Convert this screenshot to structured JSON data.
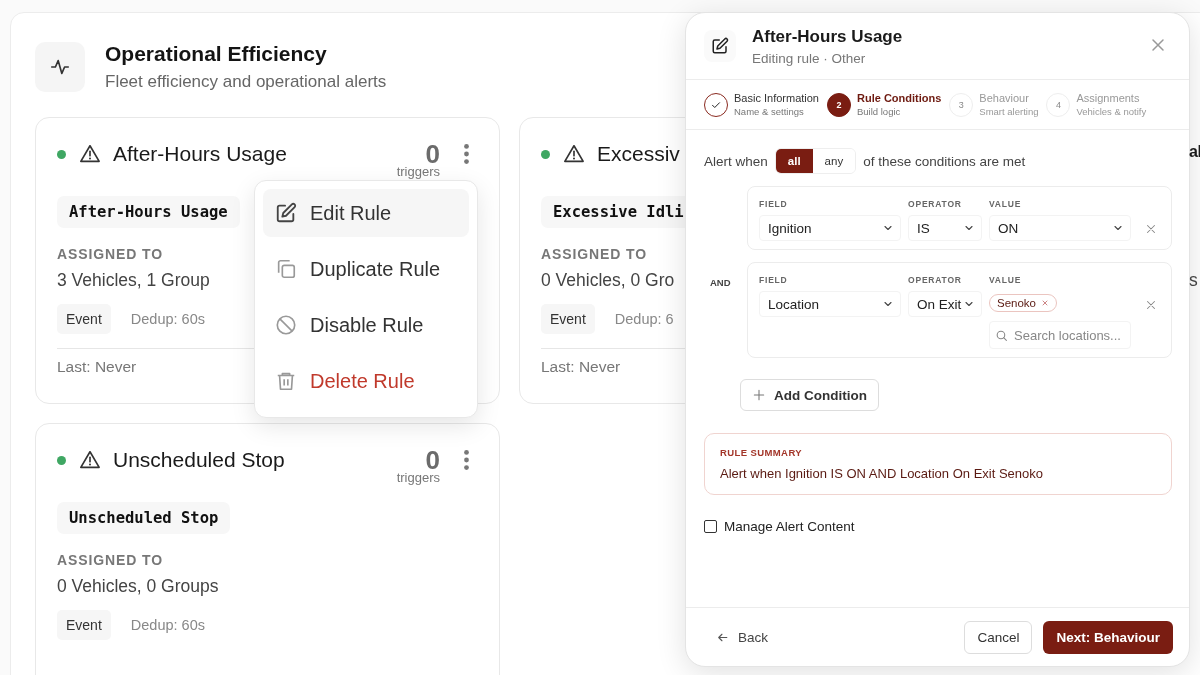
{
  "section": {
    "title": "Operational Efficiency",
    "subtitle": "Fleet efficiency and operational alerts"
  },
  "rules": [
    {
      "active": true,
      "title": "After-Hours Usage",
      "count": "0",
      "count_label": "triggers",
      "code": "After-Hours Usage",
      "assigned_label": "ASSIGNED TO",
      "assigned": "3 Vehicles, 1 Group",
      "type": "Event",
      "dedup": "Dedup: 60s",
      "last": "Last: Never"
    },
    {
      "active": true,
      "title": "Excessiv",
      "code": "Excessive Idli",
      "assigned_label": "ASSIGNED TO",
      "assigned": "0 Vehicles, 0 Gro",
      "type": "Event",
      "dedup": "Dedup: 6",
      "last": "Last: Never"
    },
    {
      "active": true,
      "title": "Unscheduled Stop",
      "count": "0",
      "count_label": "triggers",
      "code": "Unscheduled Stop",
      "assigned_label": "ASSIGNED TO",
      "assigned": "0 Vehicles, 0 Groups",
      "type": "Event",
      "dedup": "Dedup: 60s"
    }
  ],
  "edge_fragments": [
    {
      "kind": "title",
      "text": "al"
    },
    {
      "kind": "value",
      "text": "s"
    }
  ],
  "menu": {
    "items": [
      {
        "label": "Edit Rule",
        "kind": "edit",
        "highlighted": true
      },
      {
        "label": "Duplicate Rule",
        "kind": "duplicate",
        "highlighted": false
      },
      {
        "label": "Disable Rule",
        "kind": "disable",
        "highlighted": false
      },
      {
        "label": "Delete Rule",
        "kind": "delete",
        "highlighted": false
      }
    ]
  },
  "dialog": {
    "title": "After-Hours Usage",
    "subtitle": "Editing rule · Other",
    "steps": [
      {
        "completed": true,
        "selected": false,
        "title": "Basic Information",
        "subtitle": "Name & settings"
      },
      {
        "completed": false,
        "selected": true,
        "number": "2",
        "title": "Rule Conditions",
        "subtitle": "Build logic"
      },
      {
        "completed": false,
        "selected": false,
        "number": "3",
        "title": "Behaviour",
        "subtitle": "Smart alerting"
      },
      {
        "completed": false,
        "selected": false,
        "number": "4",
        "title": "Assignments",
        "subtitle": "Vehicles & notify"
      }
    ],
    "logic": {
      "prefix": "Alert when",
      "suffix": "of these conditions are met",
      "options": [
        {
          "label": "all",
          "selected": true
        },
        {
          "label": "any",
          "selected": false
        }
      ]
    },
    "conditions": [
      {
        "field_label": "FIELD",
        "field": "Ignition",
        "operator_label": "OPERATOR",
        "operator": "IS",
        "value_label": "VALUE",
        "kind": "select",
        "value": "ON"
      },
      {
        "conjunction": "AND",
        "field_label": "FIELD",
        "field": "Location",
        "operator_label": "OPERATOR",
        "operator": "On Exit",
        "value_label": "VALUE",
        "kind": "tags",
        "tags": [
          "Senoko"
        ],
        "search_placeholder": "Search locations..."
      }
    ],
    "add_condition": "Add Condition",
    "summary": {
      "label": "RULE SUMMARY",
      "text": "Alert when Ignition IS ON AND Location On Exit Senoko"
    },
    "manage_content": {
      "label": "Manage Alert Content",
      "checked": false
    },
    "back": "Back",
    "cancel": "Cancel",
    "next": "Next: Behaviour"
  }
}
